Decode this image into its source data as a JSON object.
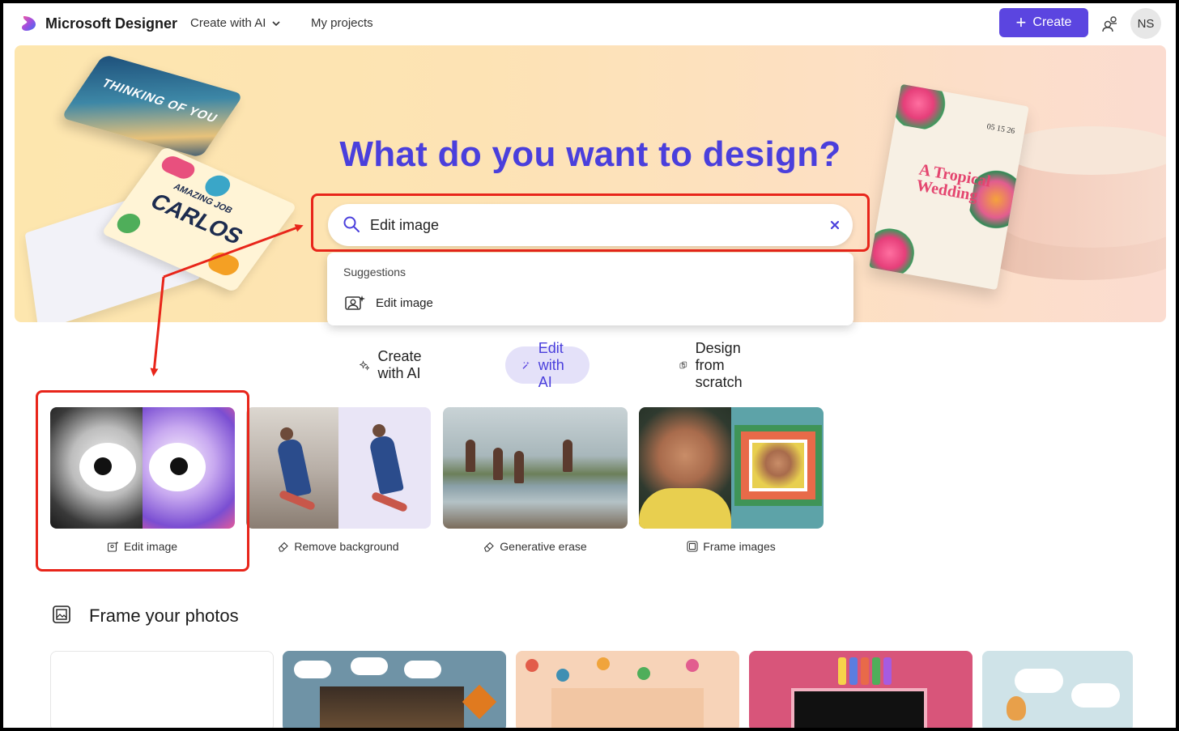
{
  "header": {
    "brand": "Microsoft Designer",
    "nav_create": "Create with AI",
    "nav_projects": "My projects",
    "create_button": "Create",
    "avatar_initials": "NS"
  },
  "hero": {
    "title": "What do you want to design?",
    "card_thinking": "THINKING OF YOU",
    "card_carlos_small": "AMAZING JOB",
    "card_carlos_big": "CARLOS",
    "invite_date": "05 15 26",
    "invite_title": "A Tropical Wedding"
  },
  "search": {
    "value": "Edit image",
    "suggestions_label": "Suggestions",
    "suggestions": [
      {
        "label": "Edit image",
        "icon": "edit-image-icon"
      }
    ]
  },
  "tabs": [
    {
      "label": "Create with AI",
      "icon": "sparkle-icon",
      "selected": false
    },
    {
      "label": "Edit with AI",
      "icon": "magic-wand-icon",
      "selected": true
    },
    {
      "label": "Design from scratch",
      "icon": "design-scratch-icon",
      "selected": false
    }
  ],
  "tools": [
    {
      "label": "Edit image",
      "icon": "edit-image-icon"
    },
    {
      "label": "Remove background",
      "icon": "eraser-icon"
    },
    {
      "label": "Generative erase",
      "icon": "eraser-icon"
    },
    {
      "label": "Frame images",
      "icon": "frame-icon"
    }
  ],
  "section": {
    "title": "Frame your photos",
    "icon": "frame-icon"
  },
  "colors": {
    "accent": "#5b45e0",
    "title": "#4a3fdc",
    "selected_tab_bg": "#e4e1f9",
    "annotation_red": "#e8251a"
  }
}
